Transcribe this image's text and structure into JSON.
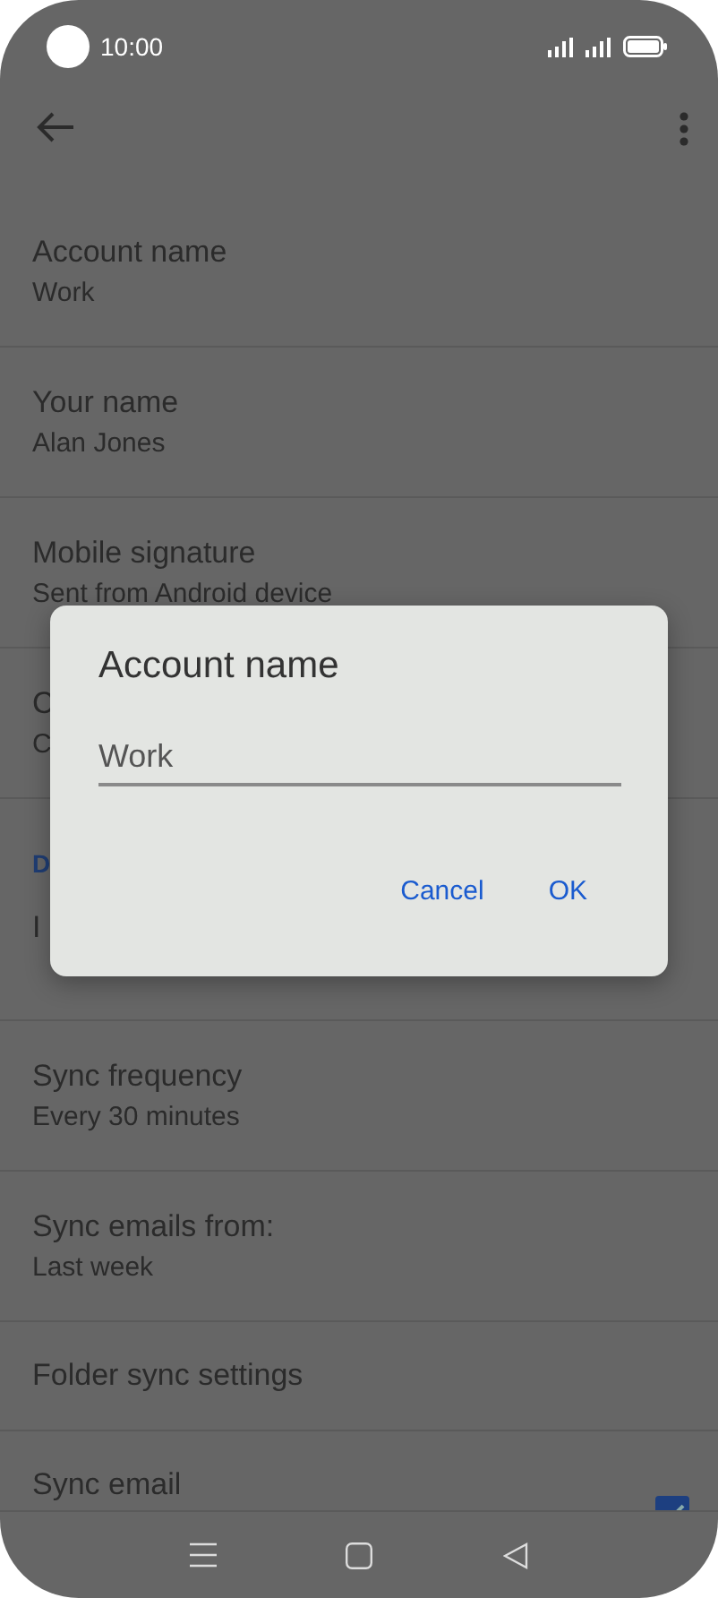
{
  "status_bar": {
    "time": "10:00"
  },
  "settings": [
    {
      "kind": "setting",
      "title": "Account name",
      "subtitle": "Work"
    },
    {
      "kind": "setting",
      "title": "Your name",
      "subtitle": "Alan Jones"
    },
    {
      "kind": "setting",
      "title": "Mobile signature",
      "subtitle": "Sent from Android device"
    },
    {
      "kind": "setting",
      "title": "C",
      "subtitle": "C"
    },
    {
      "kind": "header",
      "title": "D"
    },
    {
      "kind": "setting",
      "title": "I"
    },
    {
      "kind": "setting",
      "title": "Sync frequency",
      "subtitle": "Every 30 minutes"
    },
    {
      "kind": "setting",
      "title": "Sync emails from:",
      "subtitle": "Last week"
    },
    {
      "kind": "setting",
      "title": "Folder sync settings"
    },
    {
      "kind": "checkbox",
      "title": "Sync email",
      "checked": true
    }
  ],
  "dialog": {
    "title": "Account name",
    "field_value": "Work",
    "buttons": [
      "Cancel",
      "OK"
    ]
  }
}
